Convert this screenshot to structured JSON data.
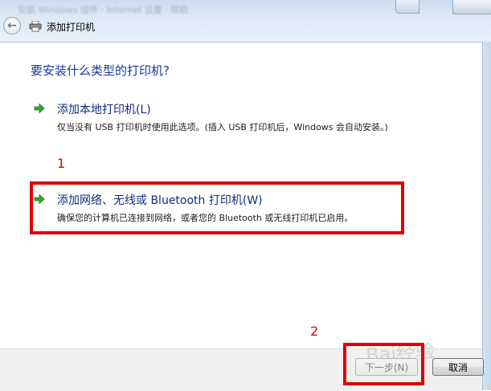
{
  "window": {
    "title": "添加打印机",
    "blurred_caption": "安装 Windows 组件 · Internet 设置 · 帮助"
  },
  "main": {
    "question": "要安装什么类型的打印机?",
    "options": [
      {
        "title": "添加本地打印机(L)",
        "description": "仅当没有 USB 打印机时使用此选项。(插入 USB 打印机后，Windows 会自动安装。)"
      },
      {
        "title": "添加网络、无线或 Bluetooth 打印机(W)",
        "description": "确保您的计算机已连接到网络，或者您的 Bluetooth 或无线打印机已启用。"
      }
    ]
  },
  "annotations": {
    "marker_1": "1",
    "marker_2": "2",
    "highlight_color": "#e00000"
  },
  "footer": {
    "next_label": "下一步(N)",
    "cancel_label": "取消"
  },
  "watermark": "Bai经验",
  "colors": {
    "heading": "#15389c",
    "option_title": "#0f2d80",
    "arrow_green": "#2fa82f",
    "footer_bg": "#f0f0f0"
  },
  "icons": {
    "back": "back-arrow-icon",
    "printer": "printer-icon",
    "option_arrow": "green-arrow-icon"
  }
}
